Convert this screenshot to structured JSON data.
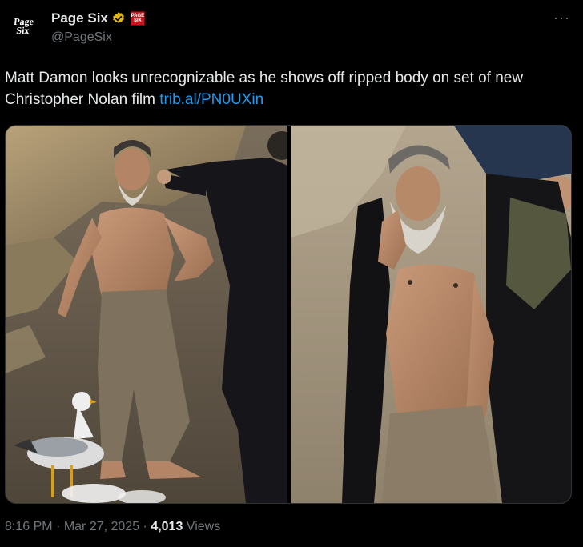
{
  "author": {
    "display_name": "Page Six",
    "handle": "@PageSix",
    "avatar_text_line1": "Page",
    "avatar_text_line2": "Six",
    "verified_color": "#e2b719",
    "affiliate_badge_text": "PAGE SIX"
  },
  "tweet": {
    "text": "Matt Damon looks unrecognizable as he shows off ripped body on set of new Christopher Nolan film ",
    "link": "trib.al/PN0UXin",
    "more_label": "···"
  },
  "media": {
    "photos": [
      "photo-left",
      "photo-right"
    ]
  },
  "meta": {
    "time": "8:16 PM",
    "separator": " · ",
    "date": "Mar 27, 2025",
    "views_count": "4,013",
    "views_label": " Views"
  },
  "colors": {
    "background": "#000000",
    "text": "#e7e9ea",
    "muted": "#71767b",
    "link": "#1d9bf0"
  }
}
